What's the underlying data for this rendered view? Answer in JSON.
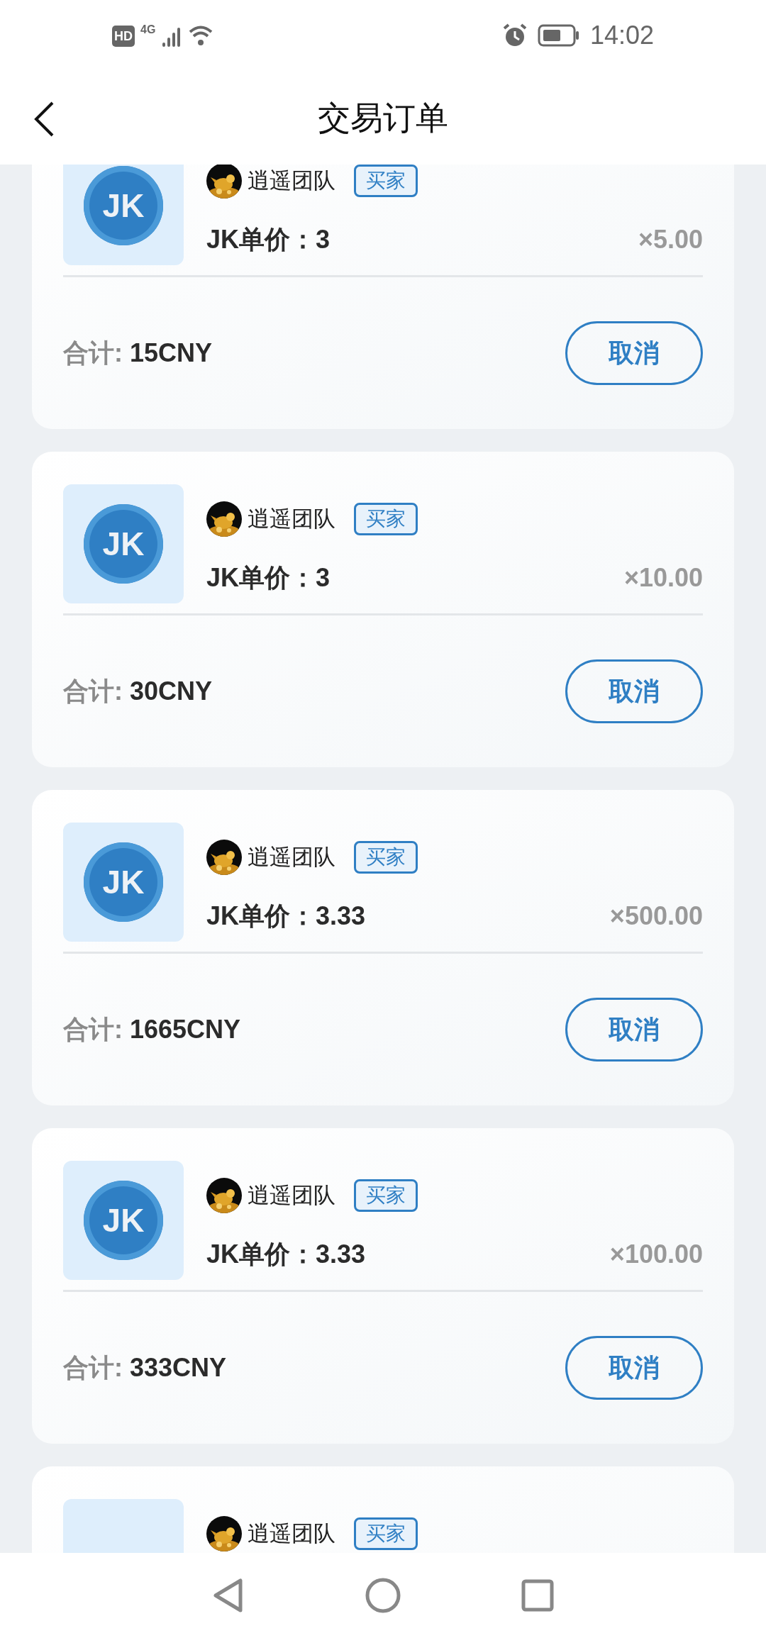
{
  "status_bar": {
    "time": "14:02",
    "hd": "HD",
    "network": "4G"
  },
  "header": {
    "title": "交易订单"
  },
  "orders": [
    {
      "coin_label": "JK",
      "seller": "逍遥团队",
      "tag": "买家",
      "price": "JK单价：3",
      "quantity": "×5.00",
      "total_label": "合计:",
      "total": "15CNY",
      "action": "取消"
    },
    {
      "coin_label": "JK",
      "seller": "逍遥团队",
      "tag": "买家",
      "price": "JK单价：3",
      "quantity": "×10.00",
      "total_label": "合计:",
      "total": "30CNY",
      "action": "取消"
    },
    {
      "coin_label": "JK",
      "seller": "逍遥团队",
      "tag": "买家",
      "price": "JK单价：3.33",
      "quantity": "×500.00",
      "total_label": "合计:",
      "total": "1665CNY",
      "action": "取消"
    },
    {
      "coin_label": "JK",
      "seller": "逍遥团队",
      "tag": "买家",
      "price": "JK单价：3.33",
      "quantity": "×100.00",
      "total_label": "合计:",
      "total": "333CNY",
      "action": "取消"
    },
    {
      "seller": "逍遥团队",
      "tag": "买家"
    }
  ]
}
